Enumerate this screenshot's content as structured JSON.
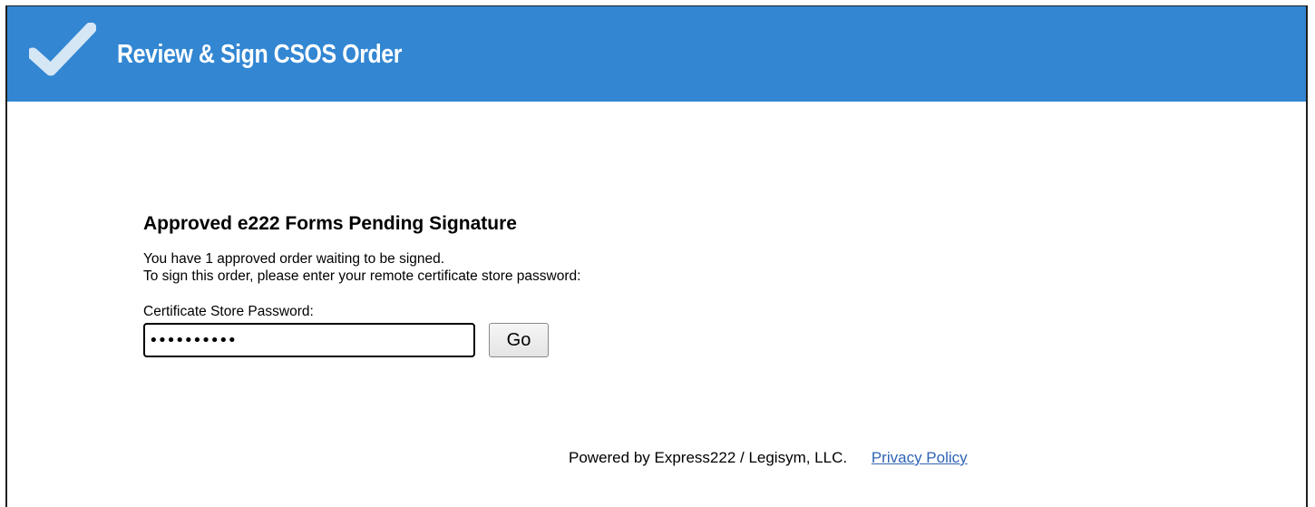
{
  "header": {
    "title": "Review & Sign CSOS Order",
    "icon": "checkmark-icon",
    "background_color": "#3286d2"
  },
  "main": {
    "heading": "Approved e222 Forms Pending Signature",
    "message_line1": "You have 1 approved order waiting to be signed.",
    "message_line2": "To sign this order, please enter your remote certificate store password:",
    "password_label": "Certificate Store Password:",
    "password_value": "••••••••••",
    "go_label": "Go"
  },
  "footer": {
    "powered_by": "Powered by Express222 / Legisym, LLC.",
    "privacy_link": "Privacy Policy",
    "link_color": "#2f63b5"
  }
}
